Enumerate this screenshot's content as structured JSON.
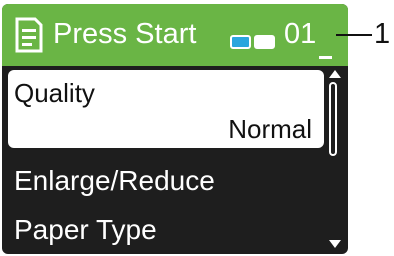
{
  "header": {
    "title": "Press Start",
    "copies": "01",
    "doc_icon": "document-icon",
    "color_indicator": {
      "color_fill": "#2aa6dd",
      "mono_fill": "#ffffff"
    },
    "background": "#6ab545"
  },
  "callout": {
    "label": "1"
  },
  "menu": {
    "items": [
      {
        "label": "Quality",
        "value": "Normal"
      },
      {
        "label": "Enlarge/Reduce"
      },
      {
        "label": "Paper Type"
      }
    ]
  },
  "scrollbar": {
    "up_icon": "scroll-up-arrow-icon",
    "down_icon": "scroll-down-arrow-icon"
  }
}
